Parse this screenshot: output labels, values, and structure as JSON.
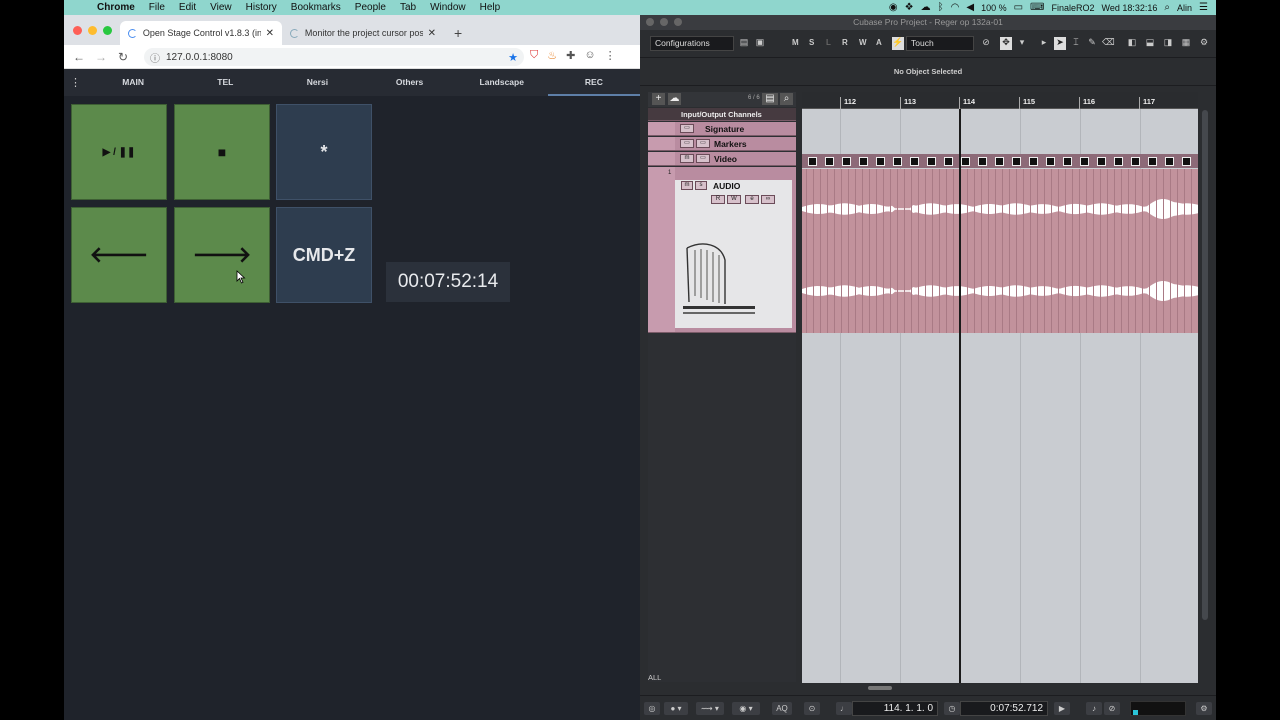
{
  "menubar": {
    "app_name": "Chrome",
    "items": [
      "File",
      "Edit",
      "View",
      "History",
      "Bookmarks",
      "People",
      "Tab",
      "Window",
      "Help"
    ],
    "battery": "100 %",
    "finale": "FinaleRO2",
    "clock": "Wed 18:32:16",
    "user": "Alin"
  },
  "chrome": {
    "tabs": [
      {
        "title": "Open Stage Control v1.8.3 (in d"
      },
      {
        "title": "Monitor the project cursor posi"
      }
    ],
    "url": "127.0.0.1:8080"
  },
  "osc": {
    "tabs": [
      "MAIN",
      "TEL",
      "Nersi",
      "Others",
      "Landscape",
      "REC"
    ],
    "active_tab": "REC",
    "buttons": {
      "play_pause": "▶ / ❚❚",
      "stop": "■",
      "star": "*",
      "left": "🡐",
      "right": "🡒",
      "cmdz": "CMD+Z"
    },
    "timecode": "00:07:52:14"
  },
  "cubase": {
    "title": "Cubase Pro Project - Reger op 132a-01",
    "configurations": "Configurations",
    "automation_mode": "Touch",
    "ms_letters": [
      "M",
      "S",
      "L",
      "R",
      "W",
      "A"
    ],
    "info_line": "No Object Selected",
    "track_count": "6 / 6",
    "tracks": {
      "folder": "Input/Output Channels",
      "signature": "Signature",
      "markers": "Markers",
      "video": "Video",
      "audio_number": "1",
      "audio": "AUDIO"
    },
    "track_buttons": {
      "m": "m",
      "s": "s",
      "r": "R",
      "w": "W",
      "e": "e"
    },
    "footer": "ALL",
    "bars": [
      "112",
      "113",
      "114",
      "115",
      "116",
      "117"
    ],
    "transport": {
      "bars_position": "114. 1. 1.   0",
      "time_position": "0:07:52.712",
      "aq": "AQ"
    }
  }
}
